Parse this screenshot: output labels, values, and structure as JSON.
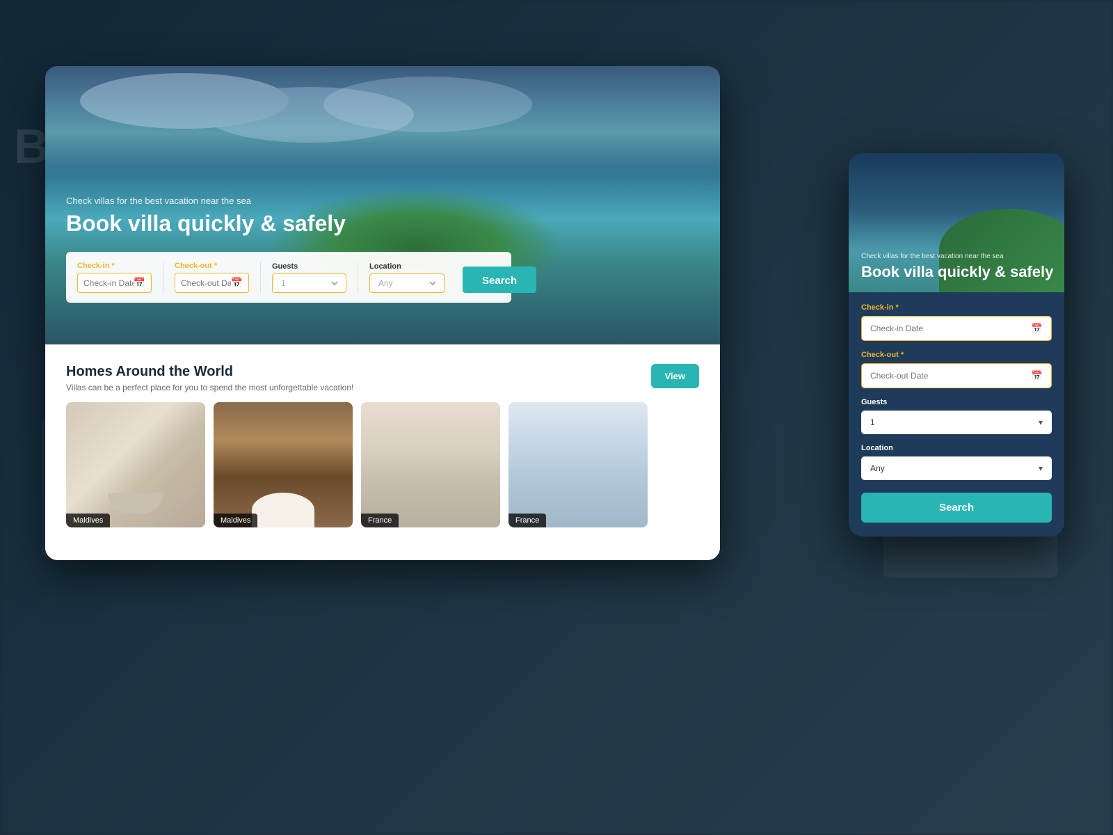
{
  "page": {
    "title": "Book villa quickly & safely",
    "tagline": "Check villas for the best vacation near the sea"
  },
  "hero": {
    "tagline": "Check villas for the best vacation near the sea",
    "title": "Book villa quickly & safely"
  },
  "searchBar": {
    "checkin_label": "Check-in",
    "checkin_required": "*",
    "checkin_placeholder": "Check-in Date",
    "checkout_label": "Check-out",
    "checkout_required": "*",
    "checkout_placeholder": "Check-out Date",
    "guests_label": "Guests",
    "guests_default": "1",
    "location_label": "Location",
    "location_default": "Any",
    "search_button": "Search"
  },
  "section": {
    "title": "Homes Around the World",
    "subtitle": "Villas can be a perfect place for you to spend the most unforgettable vacation!",
    "view_button": "View"
  },
  "properties": [
    {
      "id": 1,
      "type": "bathroom",
      "location": "Maldives"
    },
    {
      "id": 2,
      "type": "outdoor",
      "location": "Maldives"
    },
    {
      "id": 3,
      "type": "living",
      "location": "France"
    },
    {
      "id": 4,
      "type": "bedroom",
      "location": "France"
    }
  ],
  "mobileCard": {
    "tagline": "Check villas for the best vacation near the sea",
    "title": "Book villa quickly & safely",
    "checkin_label": "Check-in",
    "checkin_required": "*",
    "checkin_placeholder": "Check-in Date",
    "checkout_label": "Check-out",
    "checkout_required": "*",
    "checkout_placeholder": "Check-out Date",
    "guests_label": "Guests",
    "guests_default": "1",
    "location_label": "Location",
    "location_default": "Any",
    "search_button": "Search"
  },
  "background": {
    "partial_text": "Bo",
    "color": "#1a2a3a"
  },
  "colors": {
    "teal": "#2ab5b5",
    "gold": "#f0b429",
    "dark_bg": "#1a2a3a"
  }
}
